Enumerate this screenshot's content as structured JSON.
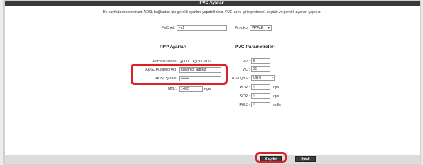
{
  "title": "PVC Ayarları",
  "description": "Bu sayfada modeminizin ADSL bağlantısı için gerekli ayarları yapabilirsiniz. PVC adını girip protokolü seçiniz ve gerekli ayarları yapınız.",
  "pvc": {
    "name_label": "PVC Adı",
    "name_value": "vc1",
    "protocol_label": "Protokol",
    "protocol_value": "PPPoE"
  },
  "ppp": {
    "heading": "PPP Ayarları",
    "encapsulation_label": "Encapsulation:",
    "encap_llc": "LLC",
    "encap_vcmux": "VCMUX",
    "encap_selected": "LLC",
    "username_label": "ADSL Kullanıcı Adı:",
    "username_value": "kullanici_adiniz",
    "password_label": "ADSL Şifresi:",
    "password_value": "●●●●",
    "mtu_label": "MTU:",
    "mtu_value": "1492",
    "mtu_unit": "byte"
  },
  "pvc_params": {
    "heading": "PVC Parametreleri",
    "vpi_label": "VPI:",
    "vpi_value": "8",
    "vci_label": "VCI:",
    "vci_value": "35",
    "atmqos_label": "ATM QoS :",
    "atmqos_value": "UBR",
    "pcr_label": "PCR :",
    "pcr_value": "0",
    "pcr_unit": "cps",
    "scr_label": "SCR :",
    "scr_value": "0",
    "scr_unit": "cps",
    "mbs_label": "MBS :",
    "mbs_value": "0",
    "mbs_unit": "cells"
  },
  "buttons": {
    "save": "Kaydet",
    "cancel": "İptal"
  },
  "colors": {
    "highlight": "#e01e26",
    "titlebar": "#3a3a3a"
  }
}
